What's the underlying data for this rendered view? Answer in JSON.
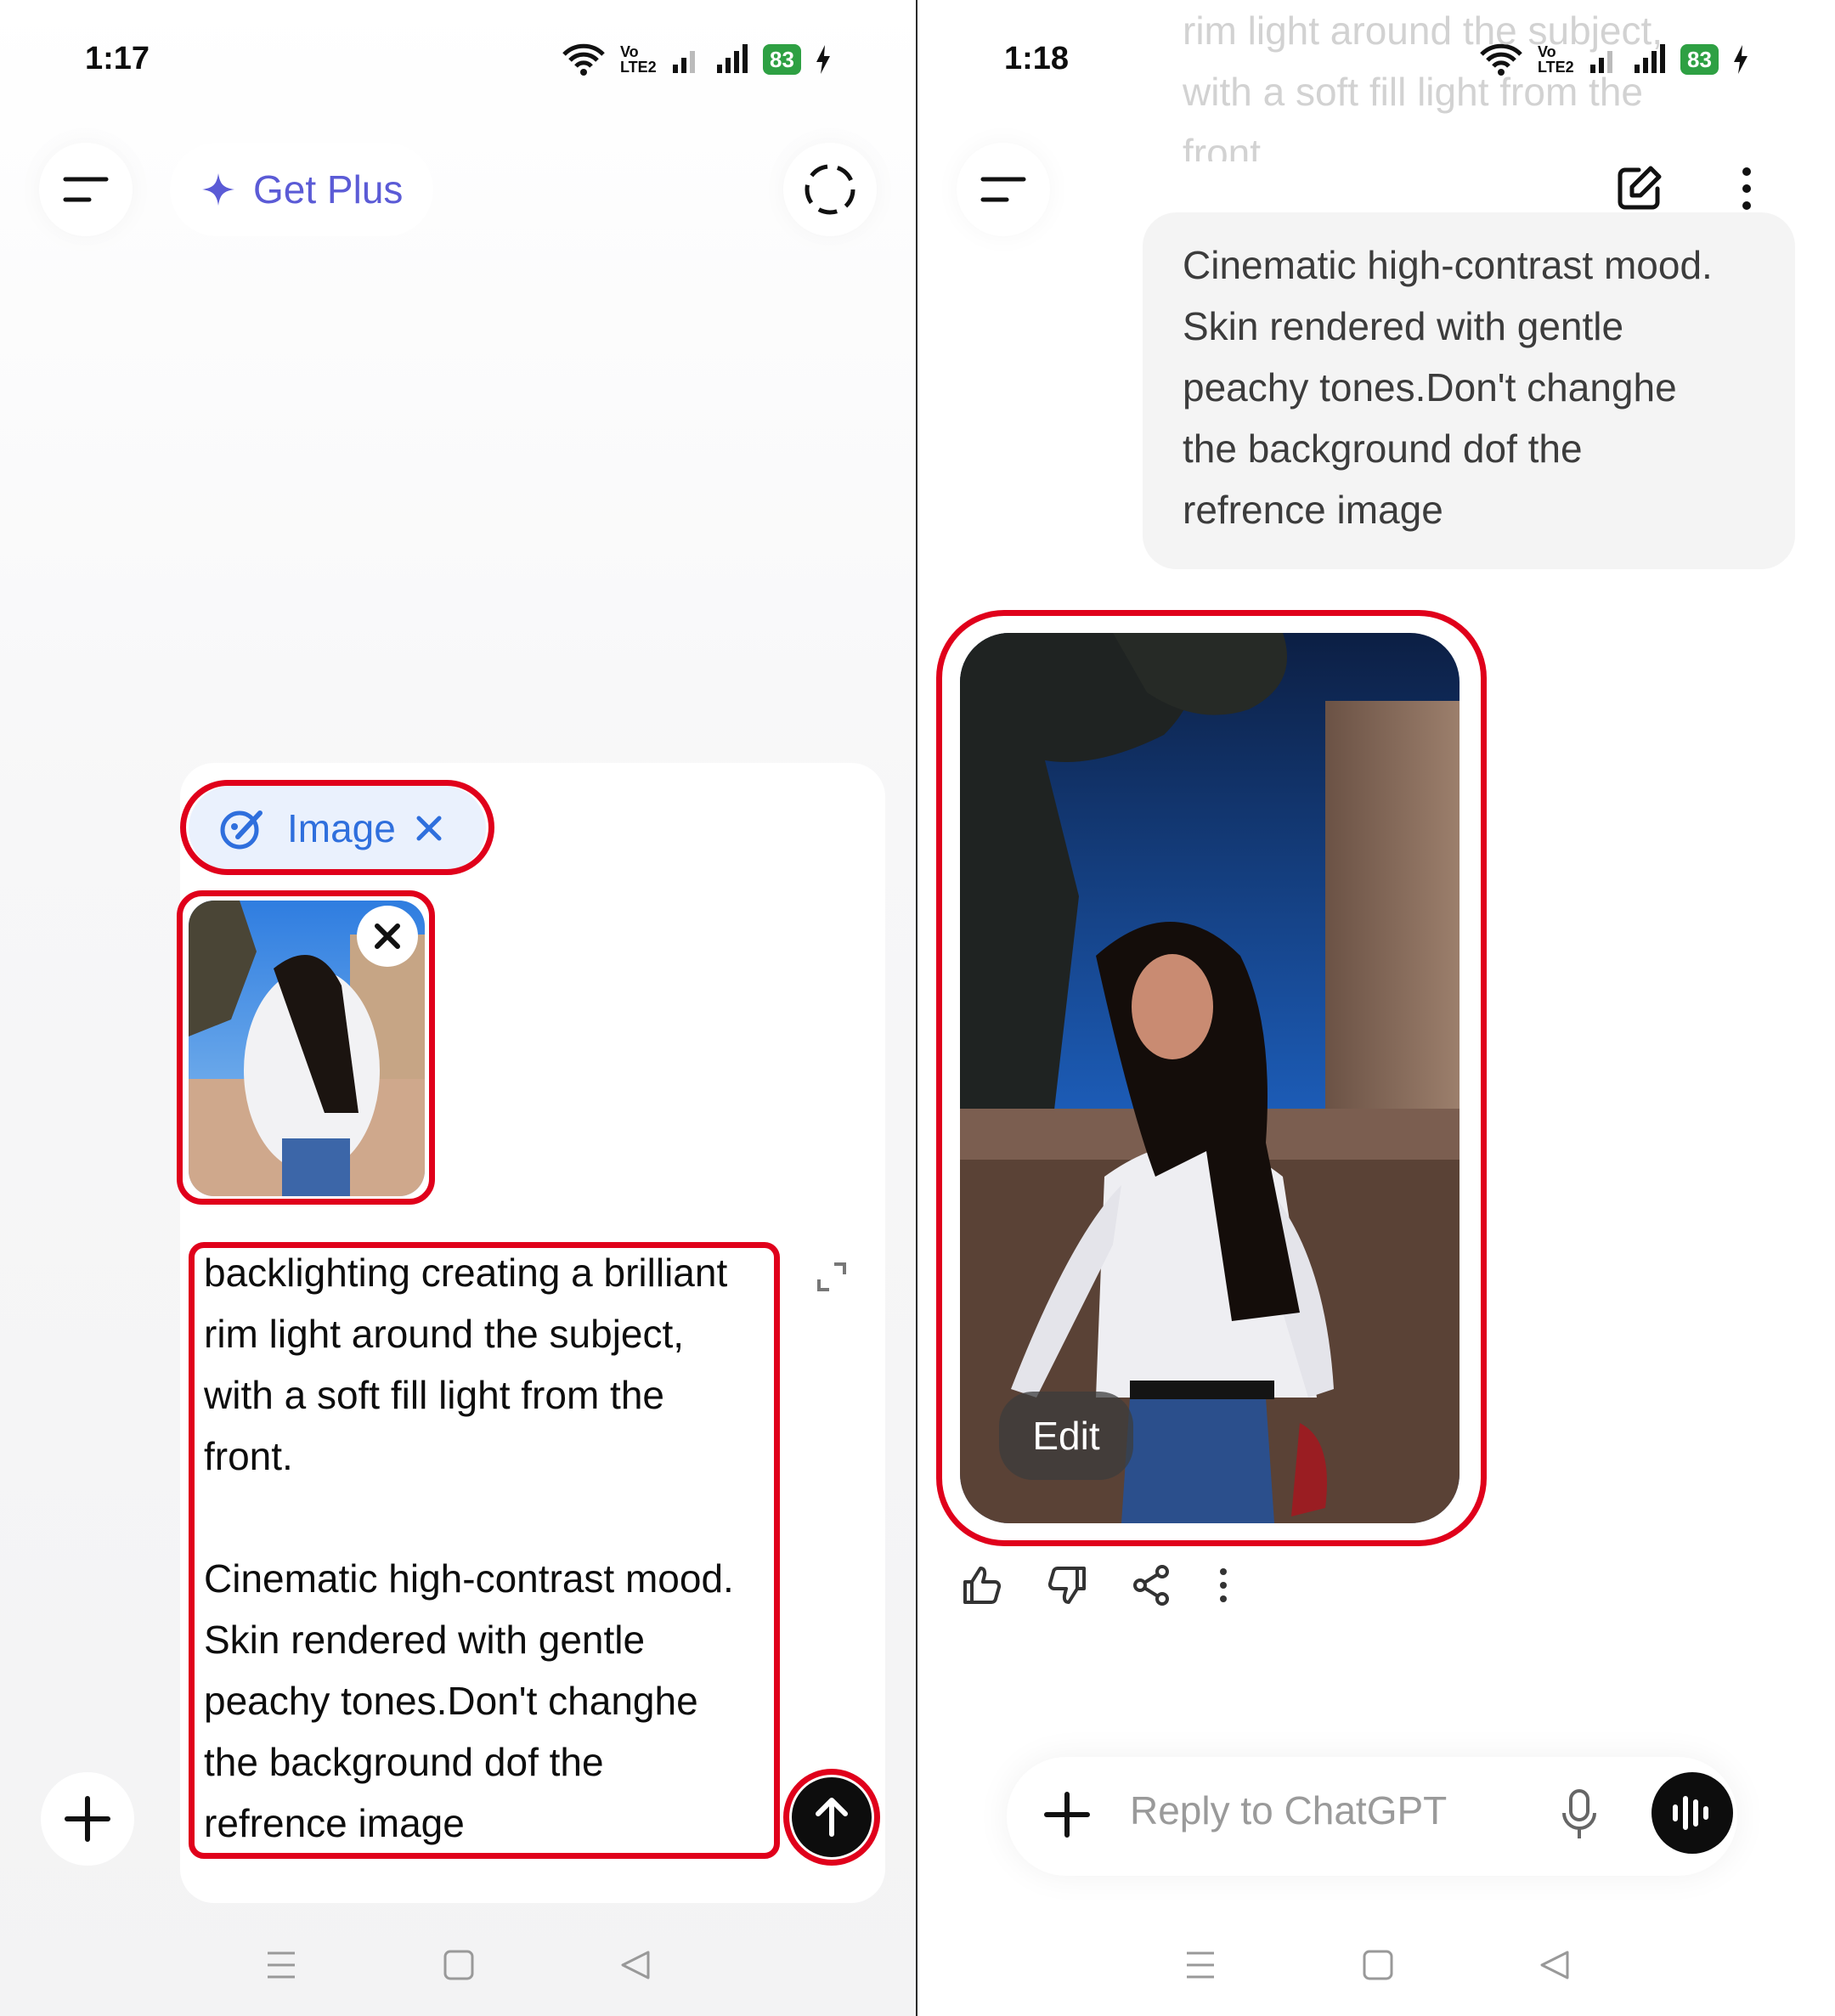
{
  "left_screen": {
    "status": {
      "time": "1:17",
      "battery": "83",
      "network": "Vo LTE2"
    },
    "header": {
      "get_plus_label": "Get Plus"
    },
    "composer": {
      "chip_label": "Image",
      "prompt_text": "backlighting creating a brilliant\nrim light around the subject,\nwith a soft fill light from the\nfront.\n\nCinematic high-contrast mood.\nSkin rendered with gentle\npeachy tones.Don't changhe\nthe background dof the\nrefrence image"
    }
  },
  "right_screen": {
    "status": {
      "time": "1:18",
      "battery": "83",
      "network": "Vo LTE2"
    },
    "faded_text": "rim light around the subject,\nwith a soft fill light from the\nfront.",
    "user_bubble_text": "Cinematic high-contrast mood.\nSkin rendered with gentle\npeachy tones.Don't changhe\nthe background dof the\nrefrence image",
    "image_edit_label": "Edit",
    "reply_placeholder": "Reply to ChatGPT"
  },
  "colors": {
    "highlight": "#e0001b",
    "accent": "#5b5bd6",
    "chip": "#2f6fdd",
    "battery": "#2ea043"
  },
  "icons": [
    "menu-icon",
    "sparkle-icon",
    "dashed-circle-icon",
    "paint-icon",
    "close-icon",
    "expand-icon",
    "send-arrow-icon",
    "plus-icon",
    "edit-compose-icon",
    "more-vertical-icon",
    "thumbs-up-icon",
    "thumbs-down-icon",
    "share-icon",
    "mic-icon",
    "voice-wave-icon",
    "nav-menu-icon",
    "nav-home-icon",
    "nav-back-icon"
  ]
}
